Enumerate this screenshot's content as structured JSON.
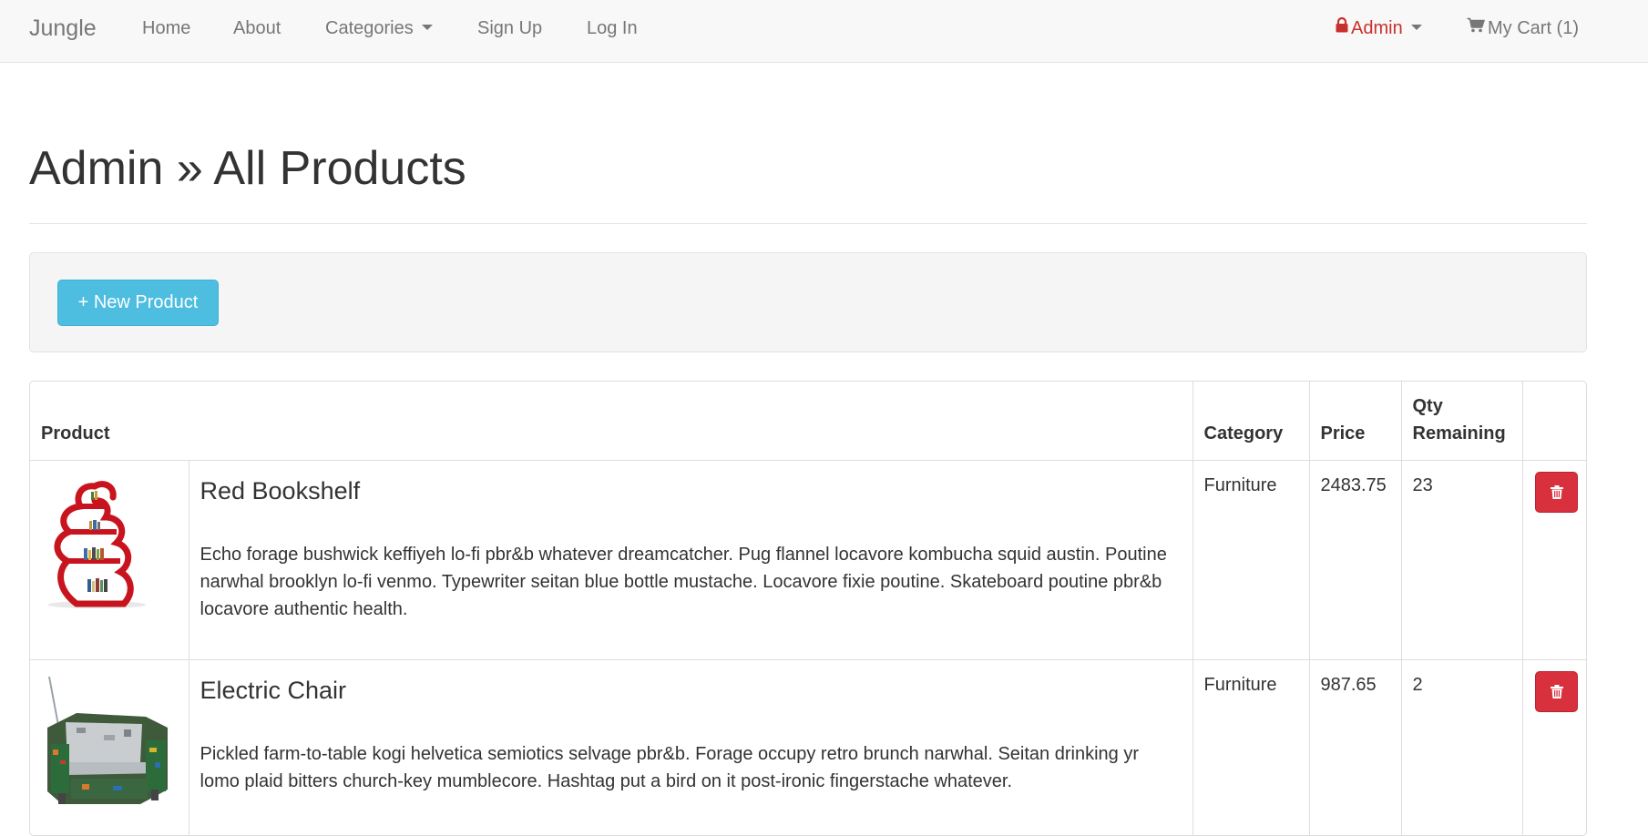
{
  "navbar": {
    "brand": "Jungle",
    "links": {
      "home": "Home",
      "about": "About",
      "categories": "Categories",
      "signup": "Sign Up",
      "login": "Log In"
    },
    "admin_label": "Admin",
    "cart_label": "My Cart (1)",
    "admin_icon": "lock-icon",
    "cart_icon": "shopping-cart-icon"
  },
  "page": {
    "title": "Admin » All Products"
  },
  "actions": {
    "new_product_label": "+ New Product"
  },
  "table": {
    "headers": {
      "product": "Product",
      "category": "Category",
      "price": "Price",
      "qty": "Qty Remaining"
    },
    "rows": [
      {
        "name": "Red Bookshelf",
        "description": "Echo forage bushwick keffiyeh lo-fi pbr&b whatever dreamcatcher. Pug flannel locavore kombucha squid austin. Poutine narwhal brooklyn lo-fi venmo. Typewriter seitan blue bottle mustache. Locavore fixie poutine. Skateboard poutine pbr&b locavore authentic health.",
        "category": "Furniture",
        "price": "2483.75",
        "qty": "23",
        "delete_icon": "trash-icon"
      },
      {
        "name": "Electric Chair",
        "description": "Pickled farm-to-table kogi helvetica semiotics selvage pbr&b. Forage occupy retro brunch narwhal. Seitan drinking yr lomo plaid bitters church-key mumblecore. Hashtag put a bird on it post-ironic fingerstache whatever.",
        "category": "Furniture",
        "price": "987.65",
        "qty": "2",
        "delete_icon": "trash-icon"
      }
    ]
  },
  "colors": {
    "navbar_bg": "#f8f8f8",
    "admin_red": "#c9302c",
    "info_button": "#4dbde0",
    "danger_button": "#d9303e"
  }
}
